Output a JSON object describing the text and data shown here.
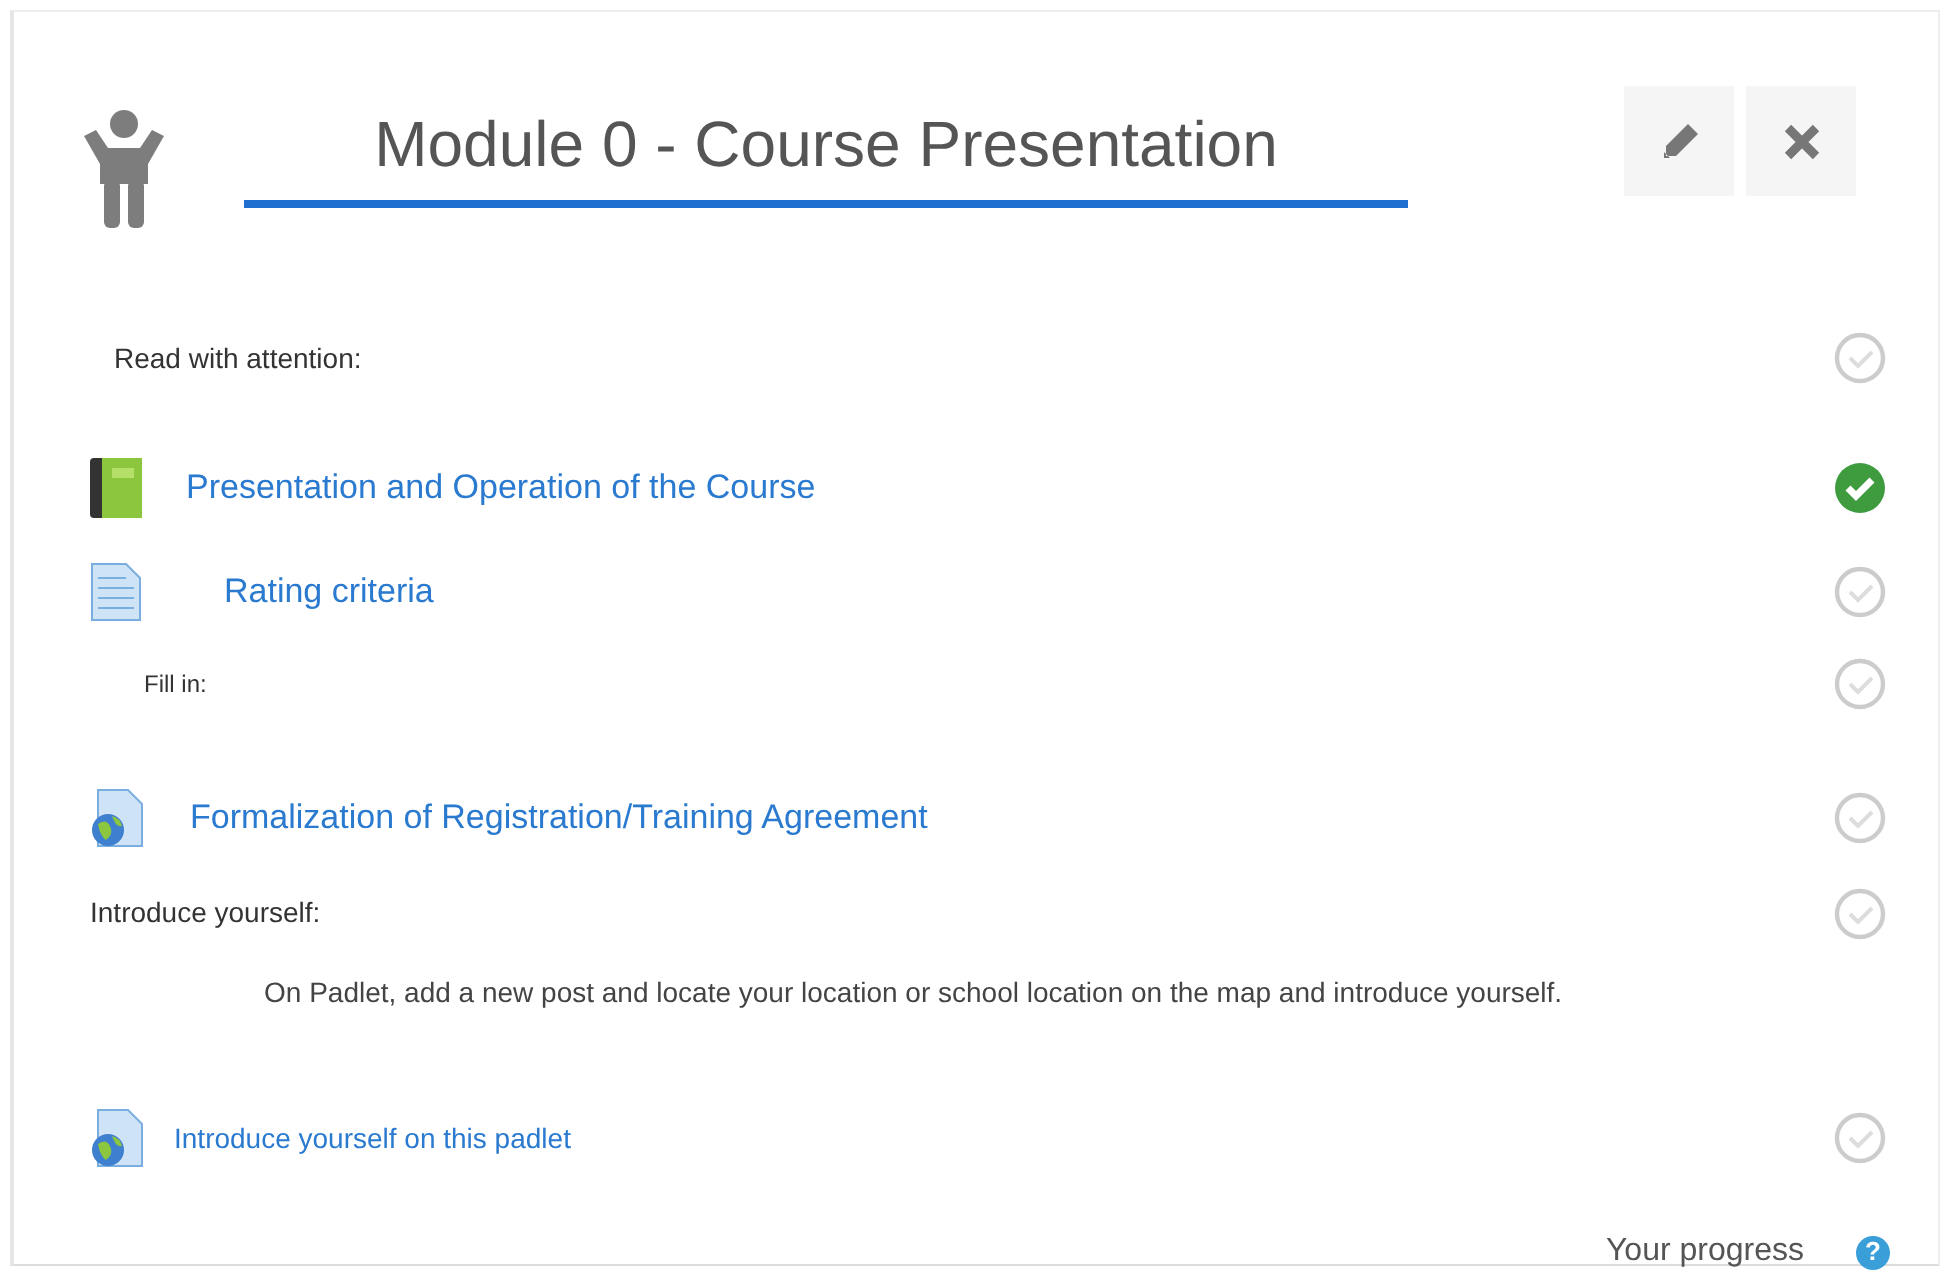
{
  "title": "Module 0 - Course Presentation",
  "items": [
    {
      "kind": "label",
      "text": "Read with attention:",
      "completed": false
    },
    {
      "kind": "book",
      "text": "Presentation and Operation of the Course",
      "completed": true
    },
    {
      "kind": "document",
      "text": "Rating criteria",
      "completed": false
    },
    {
      "kind": "label",
      "text": "Fill in:",
      "completed": false
    },
    {
      "kind": "webpage",
      "text": "Formalization of Registration/Training Agreement",
      "completed": false
    },
    {
      "kind": "label",
      "text": "Introduce yourself:",
      "completed": false
    },
    {
      "kind": "text",
      "text": "On Padlet, add a new post and locate your location or school location on the map and introduce yourself."
    },
    {
      "kind": "webpage",
      "text": "Introduce yourself on this padlet",
      "completed": false
    }
  ],
  "footer": {
    "text": "Your progress",
    "help": "?"
  }
}
